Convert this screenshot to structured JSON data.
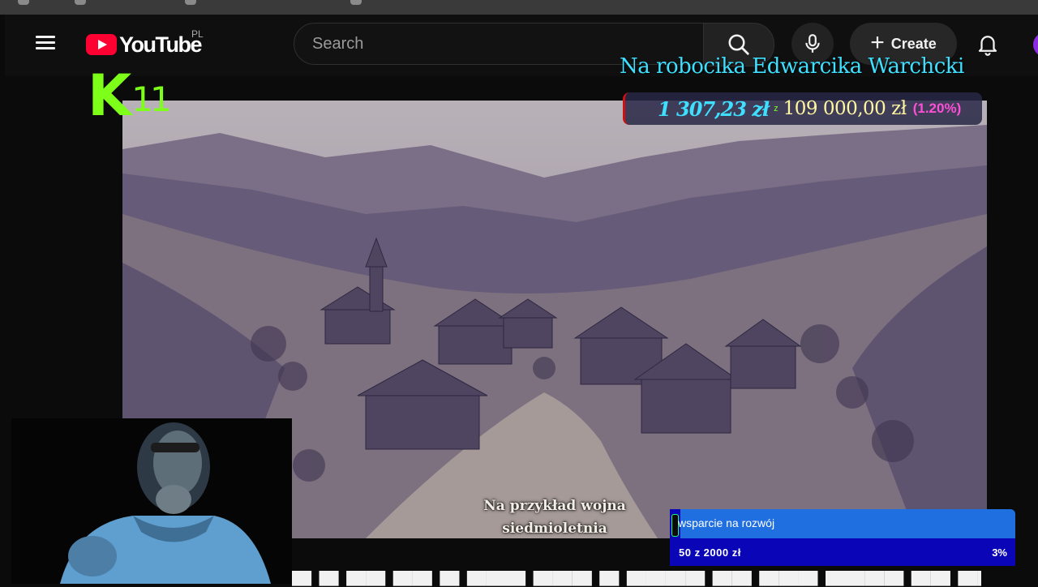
{
  "header": {
    "brand": "YouTube",
    "region": "PL",
    "create_label": "Create"
  },
  "search": {
    "placeholder": "Search",
    "value": ""
  },
  "icons": {
    "menu": "hamburger-icon",
    "search": "search-icon",
    "mic": "microphone-icon",
    "create": "plus-icon",
    "notifications": "bell-icon"
  },
  "overlay": {
    "channel_logo_letter": "K",
    "channel_logo_number": "11",
    "fundraiser": {
      "title": "Na robocika Edwarcika Warchcki",
      "raised": "1 307,23 zł",
      "separator": "z",
      "goal": "109 000,00 zł",
      "percent": "(1.20%)",
      "progress_fraction": 0.012
    },
    "support_goal": {
      "label": "wsparcie na rozwój",
      "progress_text": "50  z  2000  zł",
      "percent": "3%",
      "progress_fraction": 0.03
    }
  },
  "video": {
    "subtitle_line1": "Na przykład wojna",
    "subtitle_line2": "siedmioletnia"
  },
  "colors": {
    "youtube_red": "#ff0033",
    "header_bg": "#0f0f0f",
    "overlay_cyan": "#3fe0ff",
    "overlay_green": "#7dff1a",
    "support_blue": "#1f6fe0",
    "support_dark_blue": "#0a06b8",
    "percent_pink": "#ff4fd8"
  }
}
